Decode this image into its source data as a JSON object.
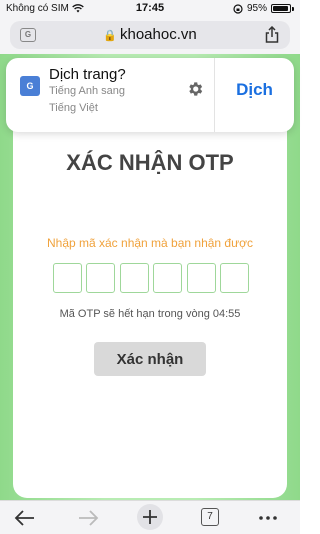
{
  "status": {
    "carrier": "Không có SIM",
    "time": "17:45",
    "battery": "95%",
    "battery_level": 0.95
  },
  "address": {
    "url": "khoahoc.vn"
  },
  "translate_popup": {
    "title": "Dịch trang?",
    "from_to_line1": "Tiếng Anh sang",
    "from_to_line2": "Tiếng Việt",
    "action": "Dịch",
    "icon_text": "G"
  },
  "page": {
    "title": "XÁC NHẬN OTP",
    "prompt": "Nhập mã xác nhận mà bạn nhận được",
    "otp_box_count": 6,
    "expire_text": "Mã OTP sẽ hết hạn trong vòng 04:55",
    "confirm_label": "Xác nhận"
  },
  "toolbar": {
    "tab_count": "7"
  },
  "colors": {
    "accent_blue": "#1a6fe0",
    "prompt_orange": "#f0a23c",
    "otp_box_border": "#9fd79a",
    "page_green": "#b8ecb3"
  }
}
